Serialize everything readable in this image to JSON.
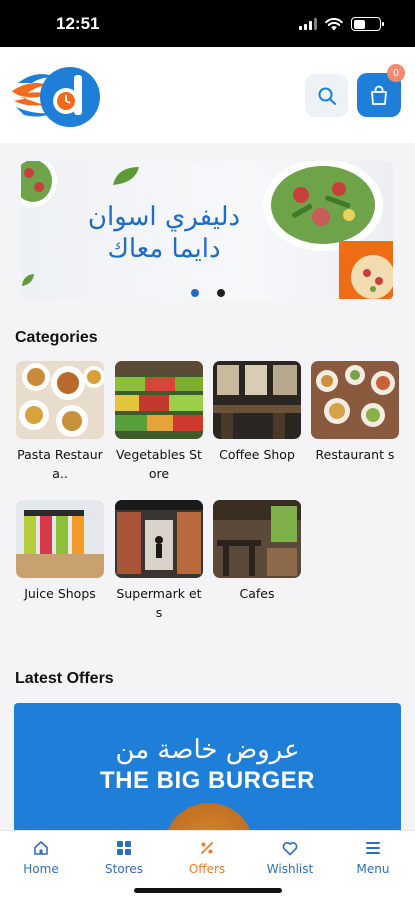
{
  "status_bar": {
    "time": "12:51"
  },
  "header": {
    "cart_count": "0"
  },
  "banner": {
    "line1": "دليفري اسوان",
    "line2": "دايما معاك",
    "active_dot": 1,
    "dot_count": 2
  },
  "categories": {
    "title": "Categories",
    "items": [
      {
        "label": "Pasta Restaura..",
        "icon": "pasta-photo"
      },
      {
        "label": "Vegetables Store",
        "icon": "vegetables-photo"
      },
      {
        "label": "Coffee Shop",
        "icon": "coffee-photo"
      },
      {
        "label": "Restaurant s",
        "icon": "restaurant-photo"
      },
      {
        "label": "Juice Shops",
        "icon": "juice-photo"
      },
      {
        "label": "Supermark ets",
        "icon": "supermarket-photo"
      },
      {
        "label": "Cafes",
        "icon": "cafe-photo"
      }
    ]
  },
  "offers": {
    "title": "Latest Offers",
    "card_arabic": "عروض خاصة من",
    "card_english": "THE BIG BURGER"
  },
  "tabbar": {
    "items": [
      {
        "label": "Home",
        "icon": "home-icon"
      },
      {
        "label": "Stores",
        "icon": "stores-icon"
      },
      {
        "label": "Offers",
        "icon": "offers-icon"
      },
      {
        "label": "Wishlist",
        "icon": "heart-icon"
      },
      {
        "label": "Menu",
        "icon": "menu-icon"
      }
    ],
    "active": "Offers"
  },
  "colors": {
    "brand_blue": "#1f7fd8",
    "accent_orange": "#ef7a2a",
    "tab_blue": "#2d6fbf"
  }
}
